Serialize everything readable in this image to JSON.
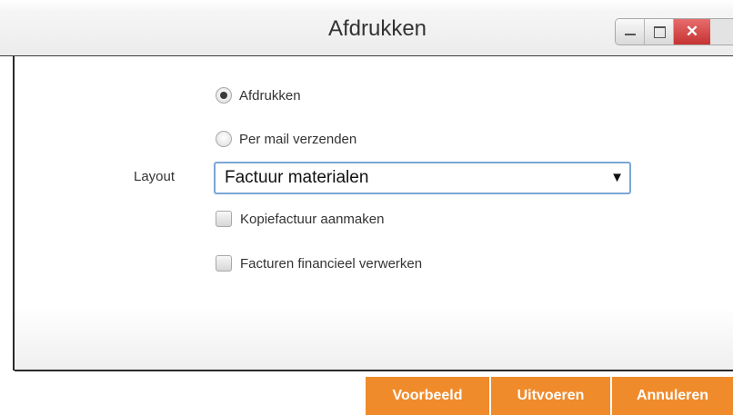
{
  "window": {
    "title": "Afdrukken",
    "close_glyph": "✕"
  },
  "form": {
    "radio_print": {
      "label": "Afdrukken",
      "checked": true
    },
    "radio_mail": {
      "label": "Per mail verzenden",
      "checked": false
    },
    "layout_label": "Layout",
    "layout_value": "Factuur materialen",
    "dropdown_arrow": "▼",
    "check_copy": {
      "label": "Kopiefactuur aanmaken",
      "checked": false
    },
    "check_financial": {
      "label": "Facturen financieel verwerken",
      "checked": false
    }
  },
  "buttons": {
    "preview": "Voorbeeld",
    "execute": "Uitvoeren",
    "cancel": "Annuleren"
  },
  "colors": {
    "accent": "#f08b2c",
    "close": "#c63333",
    "focus_border": "#7aa6d6"
  },
  "icons": [
    "minimize-icon",
    "maximize-icon",
    "close-icon",
    "chevron-down-icon"
  ]
}
